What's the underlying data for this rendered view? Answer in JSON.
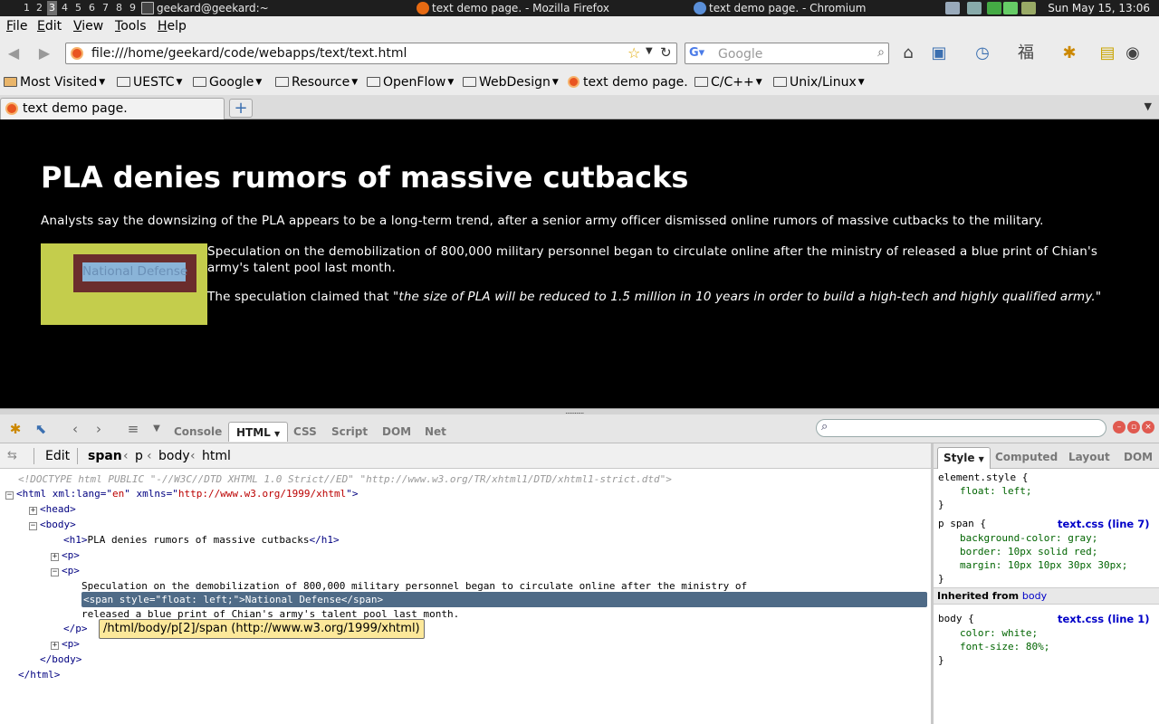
{
  "panel": {
    "workspaces": [
      "1",
      "2",
      "3",
      "4",
      "5",
      "6",
      "7",
      "8",
      "9"
    ],
    "active_workspace": 3,
    "tasks": [
      "geekard@geekard:~",
      "text demo page. - Mozilla Firefox",
      "text demo page. - Chromium"
    ],
    "clock": "Sun May 15, 13:06"
  },
  "menubar": {
    "items": [
      {
        "key": "F",
        "rest": "ile"
      },
      {
        "key": "E",
        "rest": "dit"
      },
      {
        "key": "V",
        "rest": "iew"
      },
      {
        "key": "T",
        "rest": "ools"
      },
      {
        "key": "H",
        "rest": "elp"
      }
    ]
  },
  "navbar": {
    "url": "file:///home/geekard/code/webapps/text/text.html",
    "search_engine": "Google",
    "search_placeholder": "Google"
  },
  "bookmarks": [
    {
      "label": "Most Visited",
      "icon": "most-visited-icon",
      "dropdown": true
    },
    {
      "label": "UESTC",
      "icon": "folder-icon",
      "dropdown": true
    },
    {
      "label": "Google",
      "icon": "folder-icon",
      "dropdown": true
    },
    {
      "label": "Resource",
      "icon": "folder-icon",
      "dropdown": true
    },
    {
      "label": "OpenFlow",
      "icon": "folder-icon",
      "dropdown": true
    },
    {
      "label": "WebDesign",
      "icon": "folder-icon",
      "dropdown": true
    },
    {
      "label": "text demo page.",
      "icon": "page-icon",
      "dropdown": false
    },
    {
      "label": "C/C++",
      "icon": "folder-icon",
      "dropdown": true
    },
    {
      "label": "Unix/Linux",
      "icon": "folder-icon",
      "dropdown": true
    }
  ],
  "tabs": {
    "active_label": "text demo page.",
    "new_tab": "+"
  },
  "page": {
    "heading": "PLA denies rumors of massive cutbacks",
    "p1": "Analysts say the downsizing of the PLA appears to be a long-term trend, after a senior army officer dismissed online rumors of massive cutbacks to the military.",
    "span_text": "National Defense",
    "p2": "Speculation on the demobilization of 800,000 military personnel began to circulate online after the ministry of released a blue print of Chian's army's talent pool last month.",
    "p3_prefix": "The speculation claimed that ",
    "p3_quote": "\"the size of PLA will be reduced to 1.5 million in 10 years in order to build a high-tech and highly qualified army.\""
  },
  "colors": {
    "page_bg": "#000000",
    "span_outer": "#c4cd4c",
    "span_inner": "#6b2d2d",
    "selection": "#4f6b87",
    "tooltip": "#fce89a"
  },
  "firebug": {
    "tabs": [
      "Console",
      "HTML",
      "CSS",
      "Script",
      "DOM",
      "Net"
    ],
    "active_tab": "HTML",
    "edit_label": "Edit",
    "breadcrumb": [
      "span",
      "p",
      "body",
      "html"
    ],
    "tree": {
      "doctype": "<!DOCTYPE html PUBLIC \"-//W3C//DTD XHTML 1.0 Strict//ED\" \"http://www.w3.org/TR/xhtml1/DTD/xhtml1-strict.dtd\">",
      "html_open_a": "<html xml:lang=\"",
      "html_lang": "en",
      "html_open_b": "\" xmlns=\"",
      "html_xmlns": "http://www.w3.org/1999/xhtml",
      "html_open_c": "\">",
      "head": "<head>",
      "body_open": "<body>",
      "h1_open": "<h1>",
      "h1_text": "PLA denies rumors of massive cutbacks",
      "h1_close": "</h1>",
      "p_collapsed": "<p>",
      "p_open": "<p>",
      "p_text1": "Speculation on the demobilization of 800,000 military personnel began to circulate online after the ministry of",
      "span_line": "<span style=\"float: left;\">National Defense</span>",
      "p_text2": "released a blue print of Chian's army's talent pool last month.",
      "p_close": "</p>",
      "p_collapsed2": "<p>",
      "body_close": "</body>",
      "html_close": "</html>"
    },
    "tooltip": "/html/body/p[2]/span (http://www.w3.org/1999/xhtml)",
    "side_tabs": [
      "Style",
      "Computed",
      "Layout",
      "DOM"
    ],
    "active_side_tab": "Style",
    "rules": {
      "element_selector": "element.style {",
      "element_prop": "float: left;",
      "close": "}",
      "pspan_selector": "p span {",
      "pspan_source": "text.css (line 7)",
      "pspan_props": [
        "background-color: gray;",
        "border: 10px solid red;",
        "margin: 10px 10px 30px 30px;"
      ],
      "inherited_label": "Inherited from",
      "inherited_from": "body",
      "body_selector": "body {",
      "body_source": "text.css (line 1)",
      "body_props": [
        "color: white;",
        "font-size: 80%;"
      ]
    }
  }
}
